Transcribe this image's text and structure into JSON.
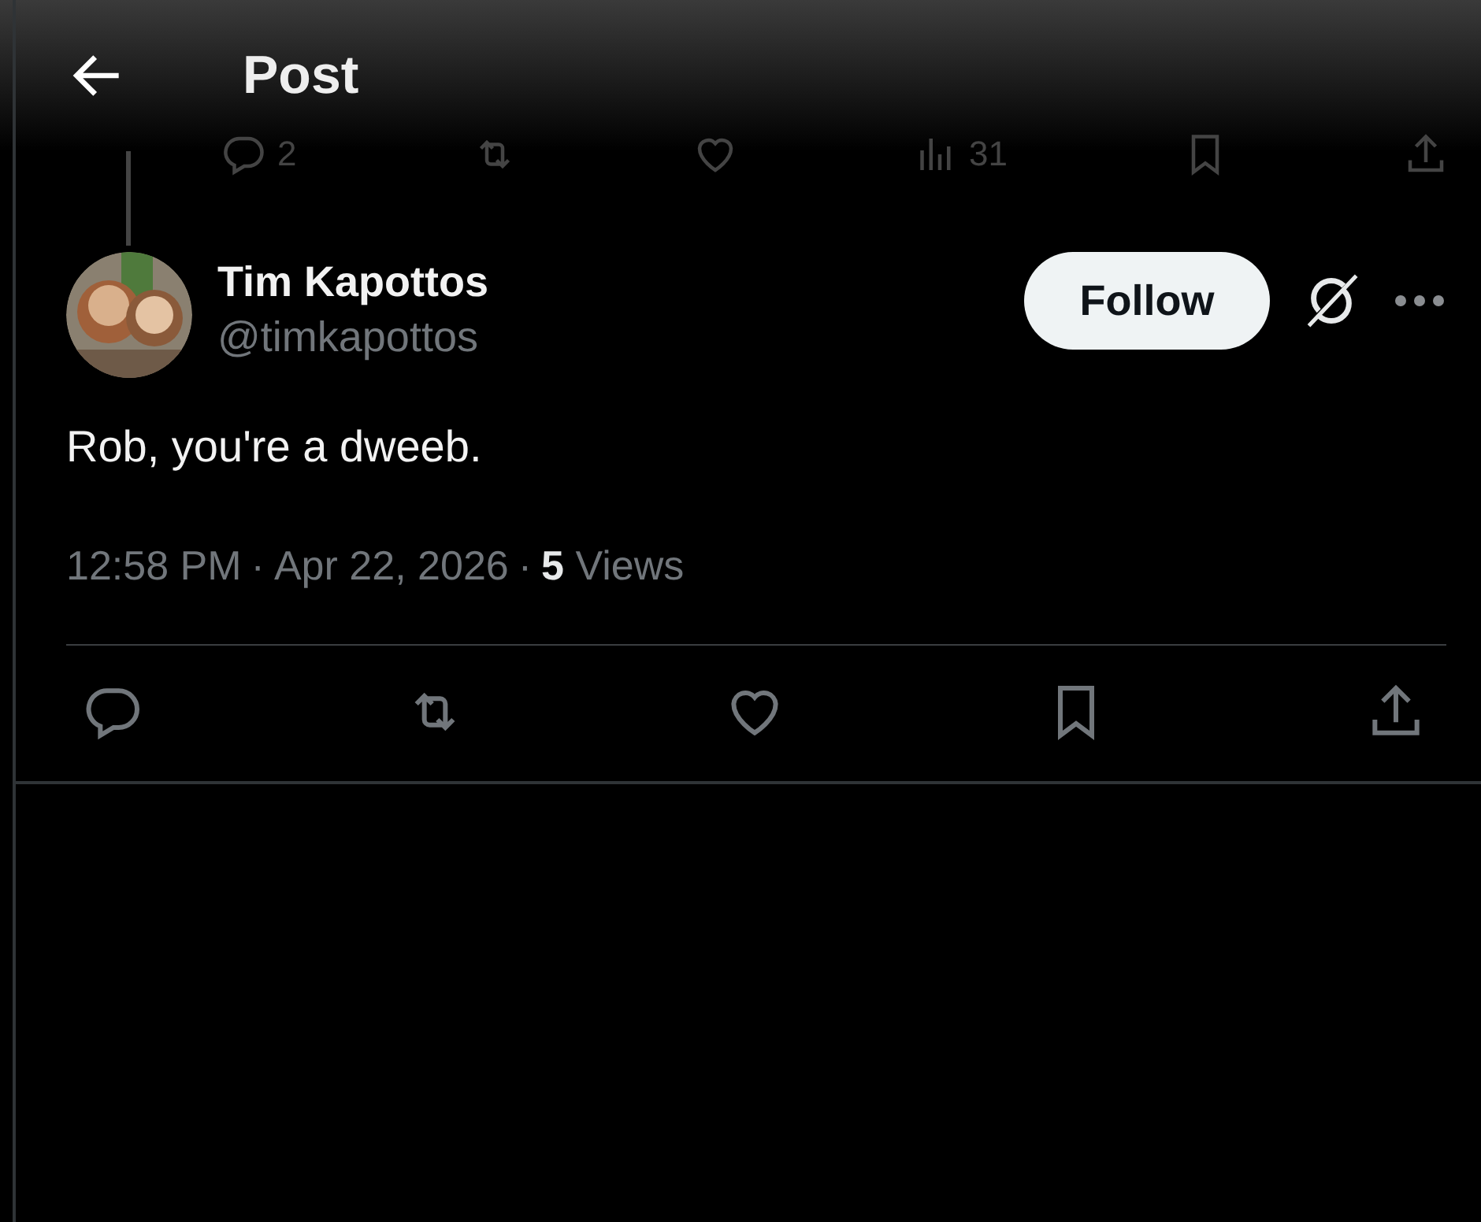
{
  "header": {
    "title": "Post"
  },
  "previous_post": {
    "actions": [
      {
        "kind": "reply",
        "count": "2"
      },
      {
        "kind": "repost"
      },
      {
        "kind": "like"
      },
      {
        "kind": "views",
        "count": "31"
      },
      {
        "kind": "bookmark"
      },
      {
        "kind": "share"
      }
    ]
  },
  "post": {
    "author": {
      "name": "Tim Kapottos",
      "handle": "@timkapottos"
    },
    "follow_button": "Follow",
    "text": "Rob, you're a dweeb.",
    "time": "12:58 PM",
    "date": "Apr 22, 2026",
    "separators": [
      "·",
      "·"
    ],
    "views_count": "5",
    "views_label": "Views",
    "actions": [
      {
        "kind": "reply"
      },
      {
        "kind": "repost"
      },
      {
        "kind": "like"
      },
      {
        "kind": "bookmark"
      },
      {
        "kind": "share"
      }
    ]
  }
}
